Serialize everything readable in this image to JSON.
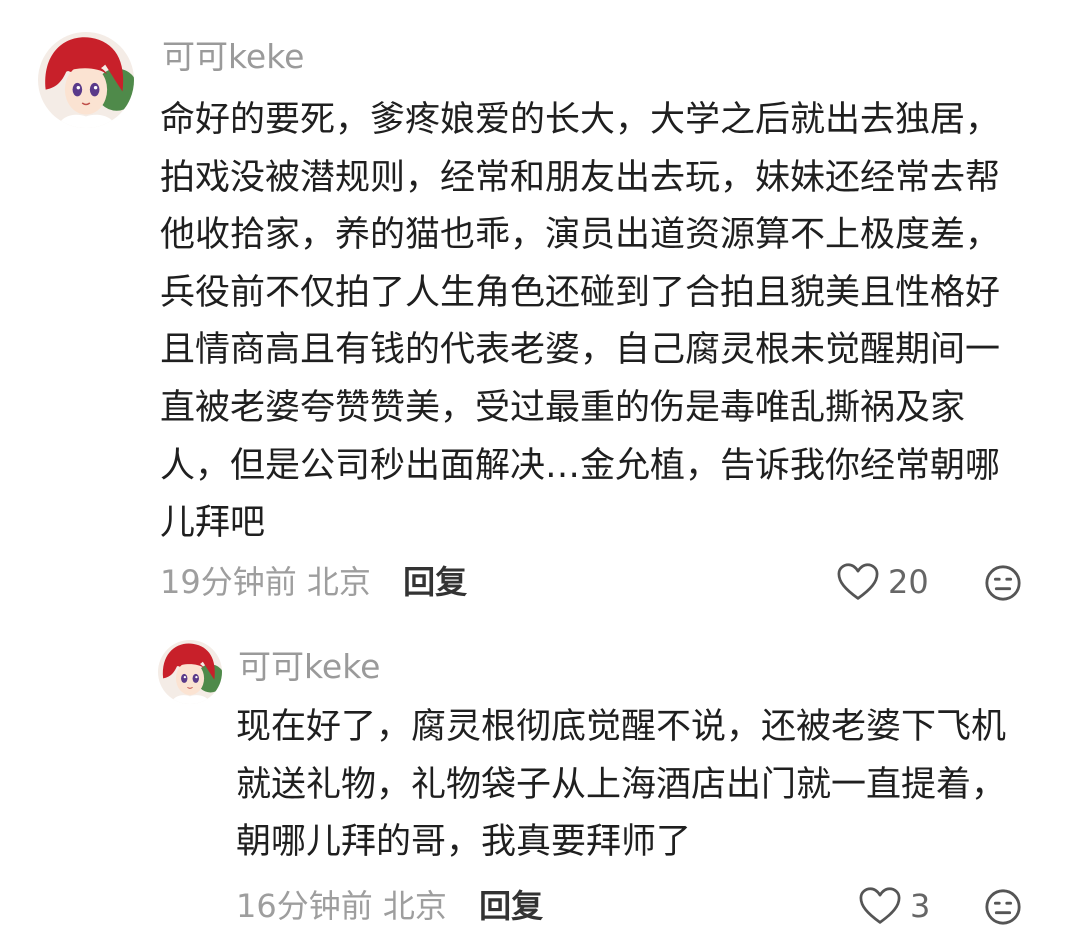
{
  "comments": [
    {
      "username": "可可keke",
      "lines": [
        "命好的要死，爹疼娘爱的长大，大学之后就出去独居，",
        "拍戏没被潜规则，经常和朋友出去玩，妹妹还经常去帮",
        "他收拾家，养的猫也乖，演员出道资源算不上极度差，",
        "兵役前不仅拍了人生角色还碰到了合拍且貌美且性格好",
        "且情商高且有钱的代表老婆，自己腐灵根未觉醒期间一",
        "直被老婆夸赞赞美，受过最重的伤是毒唯乱撕祸及家",
        "人，但是公司秒出面解决…金允植，告诉我你经常朝哪",
        "儿拜吧"
      ],
      "time": "19分钟前",
      "location": "北京",
      "reply_label": "回复",
      "likes": "20",
      "avatar_icon": "anime-girl-avatar",
      "accent_hair": "#c8202a"
    },
    {
      "username": "可可keke",
      "lines": [
        "现在好了，腐灵根彻底觉醒不说，还被老婆下飞机",
        "就送礼物，礼物袋子从上海酒店出门就一直提着，",
        "朝哪儿拜的哥，我真要拜师了"
      ],
      "time": "16分钟前",
      "location": "北京",
      "reply_label": "回复",
      "likes": "3",
      "avatar_icon": "anime-girl-avatar",
      "accent_hair": "#c8202a"
    }
  ],
  "icons": {
    "like": "heart-outline-icon",
    "dislike": "frown-face-icon"
  }
}
